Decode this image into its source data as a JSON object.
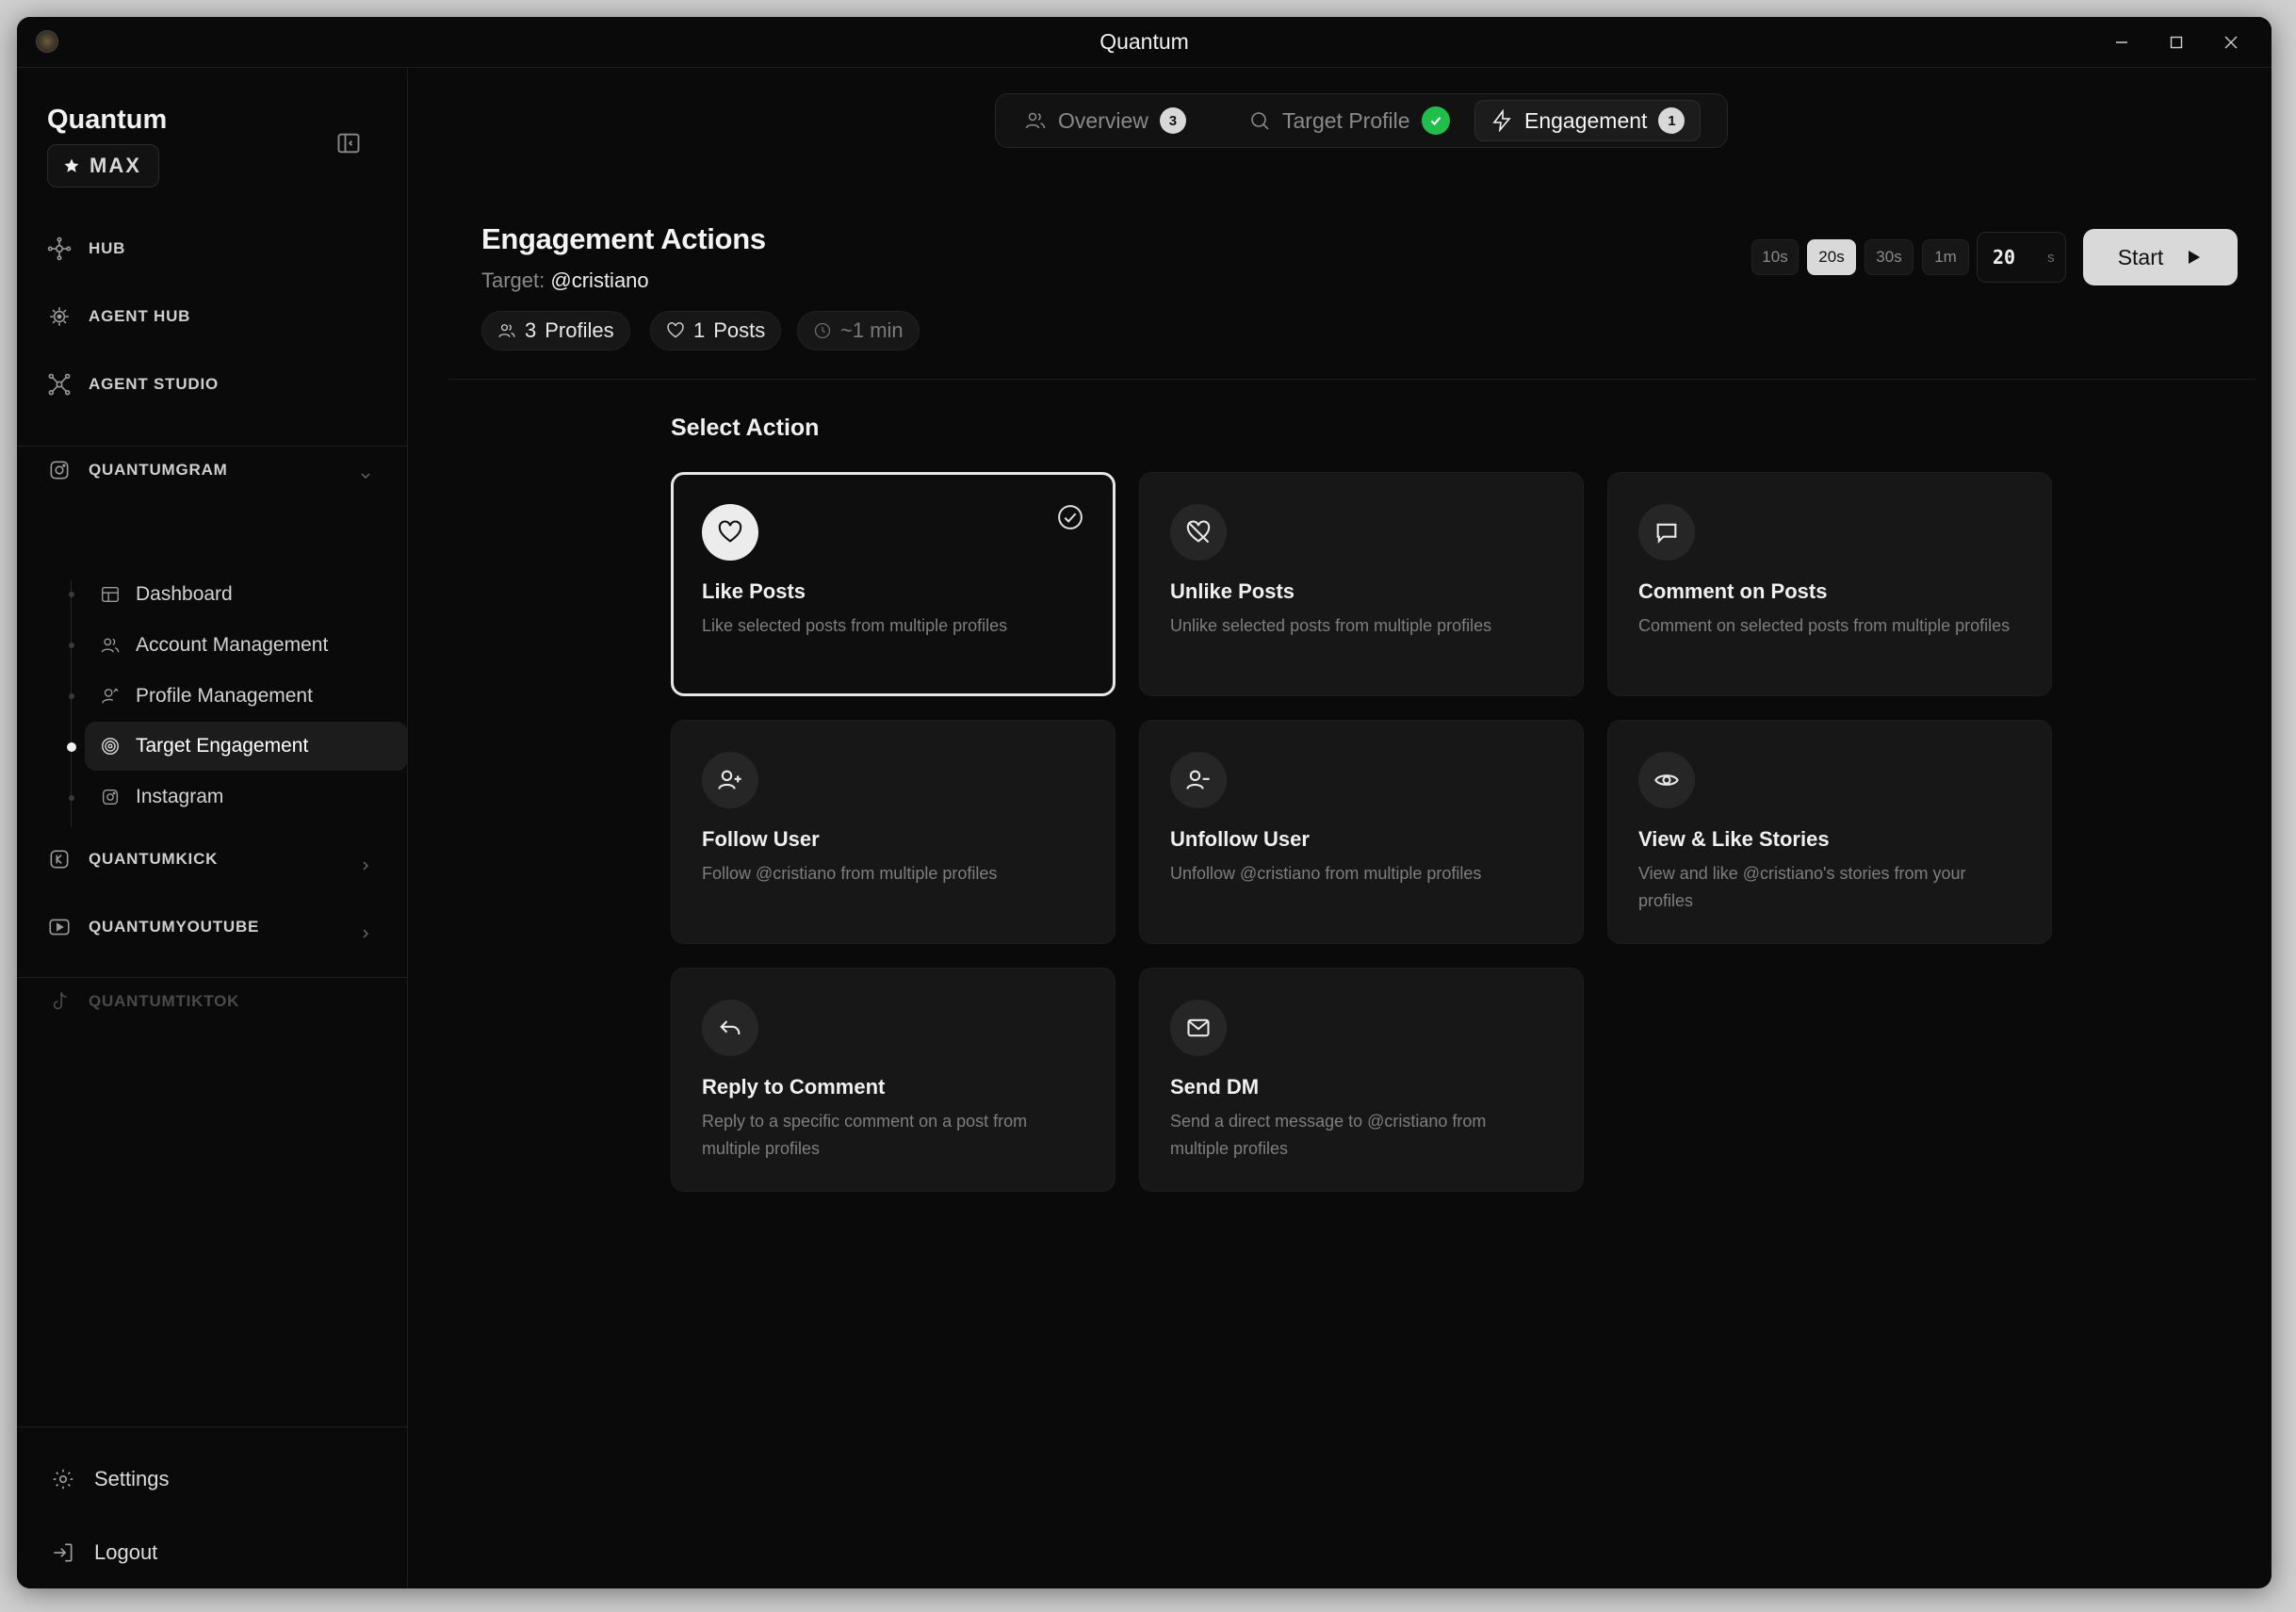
{
  "window": {
    "title": "Quantum"
  },
  "sidebar": {
    "brand": "Quantum",
    "plan": "MAX",
    "nav": [
      {
        "label": "HUB",
        "icon": "hub-icon"
      },
      {
        "label": "AGENT HUB",
        "icon": "agent-hub-icon"
      },
      {
        "label": "AGENT STUDIO",
        "icon": "agent-studio-icon"
      }
    ],
    "sections": {
      "quantumgram": "QUANTUMGRAM",
      "quantumkick": "QUANTUMKICK",
      "quantumyoutube": "QUANTUMYOUTUBE",
      "quantumtiktok": "QUANTUMTIKTOK"
    },
    "sub_items": [
      {
        "label": "Dashboard"
      },
      {
        "label": "Account Management"
      },
      {
        "label": "Profile Management"
      },
      {
        "label": "Target Engagement",
        "active": true
      },
      {
        "label": "Instagram"
      }
    ],
    "settings": "Settings",
    "logout": "Logout"
  },
  "tabs": [
    {
      "label": "Overview",
      "badge": "3"
    },
    {
      "label": "Target Profile",
      "done": true
    },
    {
      "label": "Engagement",
      "badge": "1",
      "active": true
    }
  ],
  "header": {
    "title": "Engagement Actions",
    "target_label": "Target:",
    "target_value": "@cristiano",
    "profiles_count": "3",
    "profiles_label": "Profiles",
    "posts_count": "1",
    "posts_label": "Posts",
    "duration": "~1 min"
  },
  "controls": {
    "intervals": [
      "10s",
      "20s",
      "30s",
      "1m"
    ],
    "selected_interval": "20s",
    "seconds_value": "20",
    "seconds_unit": "s",
    "start_label": "Start"
  },
  "actions": {
    "section_label": "Select Action",
    "cards": [
      {
        "title": "Like Posts",
        "desc": "Like selected posts from multiple profiles",
        "icon": "heart-icon",
        "selected": true
      },
      {
        "title": "Unlike Posts",
        "desc": "Unlike selected posts from multiple profiles",
        "icon": "heart-off-icon"
      },
      {
        "title": "Comment on Posts",
        "desc": "Comment on selected posts from multiple profiles",
        "icon": "comment-icon"
      },
      {
        "title": "Follow User",
        "desc": "Follow @cristiano from multiple profiles",
        "icon": "user-plus-icon"
      },
      {
        "title": "Unfollow User",
        "desc": "Unfollow @cristiano from multiple profiles",
        "icon": "user-minus-icon"
      },
      {
        "title": "View & Like Stories",
        "desc": "View and like @cristiano's stories from your profiles",
        "icon": "eye-icon"
      },
      {
        "title": "Reply to Comment",
        "desc": "Reply to a specific comment on a post from multiple profiles",
        "icon": "reply-icon"
      },
      {
        "title": "Send DM",
        "desc": "Send a direct message to @cristiano from multiple profiles",
        "icon": "mail-icon"
      }
    ]
  },
  "colors": {
    "background": "#0a0a0a",
    "card": "#171717",
    "accent_light": "#d9d9d9",
    "success": "#1fbf4a"
  }
}
